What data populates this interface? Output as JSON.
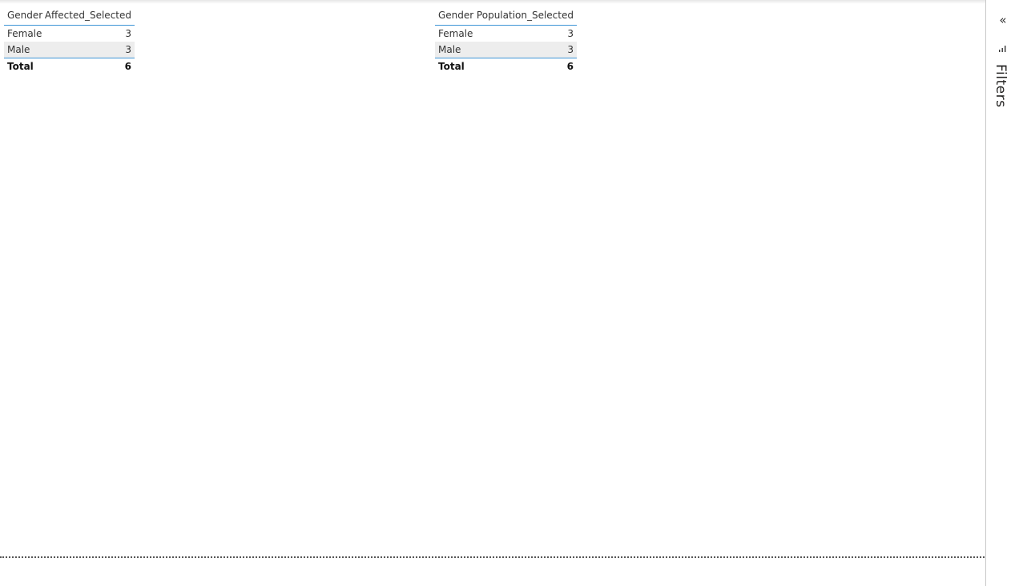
{
  "tables": [
    {
      "headers": [
        "Gender",
        "Affected_Selected"
      ],
      "rows": [
        {
          "label": "Female",
          "value": "3"
        },
        {
          "label": "Male",
          "value": "3"
        }
      ],
      "total": {
        "label": "Total",
        "value": "6"
      }
    },
    {
      "headers": [
        "Gender",
        "Population_Selected"
      ],
      "rows": [
        {
          "label": "Female",
          "value": "3"
        },
        {
          "label": "Male",
          "value": "3"
        }
      ],
      "total": {
        "label": "Total",
        "value": "6"
      }
    }
  ],
  "filters_pane": {
    "label": "Filters",
    "collapse_glyph": "«",
    "icons": [
      "collapse-chevrons-icon",
      "filter-icon"
    ]
  },
  "colors": {
    "accent_border": "#3e95d6",
    "row_highlight": "#ededed"
  }
}
